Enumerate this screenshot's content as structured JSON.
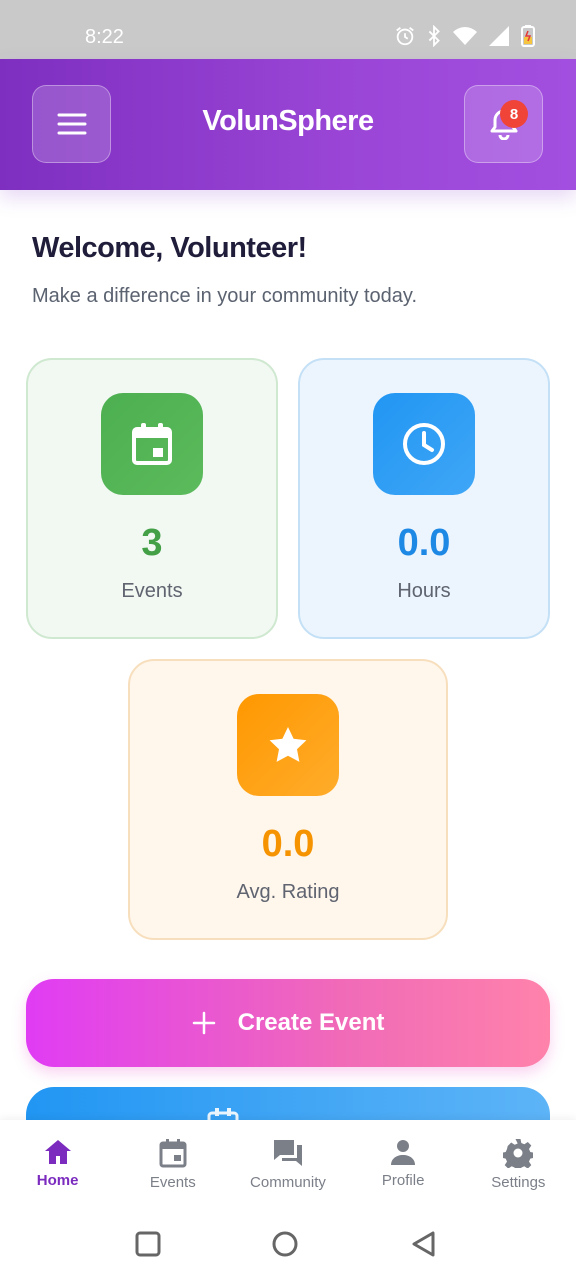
{
  "status_bar": {
    "time": "8:22"
  },
  "header": {
    "title": "VolunSphere",
    "notification_count": "8"
  },
  "welcome": {
    "title": "Welcome, Volunteer!",
    "subtitle": "Make a difference in your community today."
  },
  "stats": [
    {
      "value": "3",
      "label": "Events",
      "icon": "calendar-icon",
      "color": "#4caf50"
    },
    {
      "value": "0.0",
      "label": "Hours",
      "icon": "clock-icon",
      "color": "#2196f3"
    },
    {
      "value": "0.0",
      "label": "Avg. Rating",
      "icon": "star-icon",
      "color": "#ff9800"
    }
  ],
  "actions": {
    "create_event_label": "Create Event"
  },
  "bottom_nav": {
    "items": [
      {
        "label": "Home",
        "icon": "home-icon",
        "active": true
      },
      {
        "label": "Events",
        "icon": "calendar-icon",
        "active": false
      },
      {
        "label": "Community",
        "icon": "chat-icon",
        "active": false
      },
      {
        "label": "Profile",
        "icon": "person-icon",
        "active": false
      },
      {
        "label": "Settings",
        "icon": "gear-icon",
        "active": false
      }
    ]
  },
  "colors": {
    "accent": "#7b2cbf",
    "header_start": "#7e2fc0",
    "header_end": "#a24fe0",
    "badge": "#f04438"
  }
}
